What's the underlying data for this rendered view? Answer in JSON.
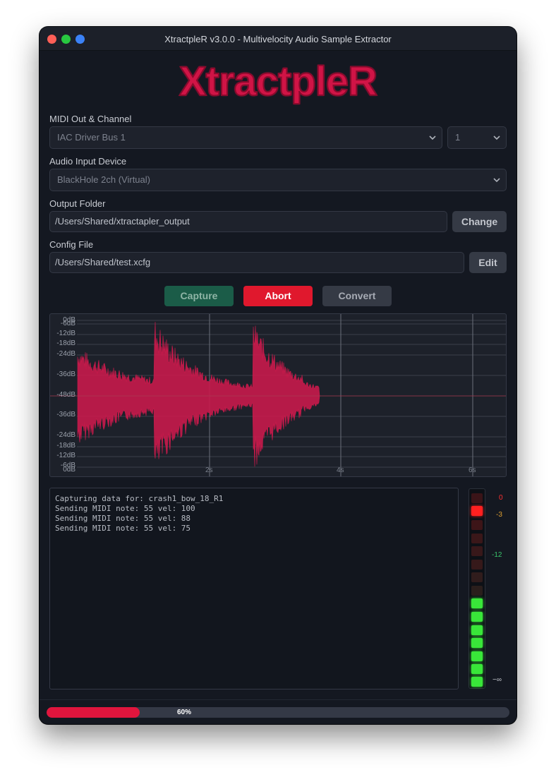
{
  "window": {
    "title": "XtractpleR v3.0.0 - Multivelocity Audio Sample Extractor",
    "logo_text": "XtractpleR"
  },
  "midi": {
    "label": "MIDI Out & Channel",
    "device": "IAC Driver Bus 1",
    "channel": "1"
  },
  "audio": {
    "label": "Audio Input Device",
    "device": "BlackHole 2ch (Virtual)"
  },
  "output": {
    "label": "Output Folder",
    "path": "/Users/Shared/xtractapler_output",
    "change_label": "Change"
  },
  "config": {
    "label": "Config File",
    "path": "/Users/Shared/test.xcfg",
    "edit_label": "Edit"
  },
  "actions": {
    "capture": "Capture",
    "abort": "Abort",
    "convert": "Convert"
  },
  "waveform": {
    "db_labels_top": [
      "0dB",
      "-6dB",
      "-12dB",
      "-18dB",
      "-24dB",
      "-36dB",
      "-48dB"
    ],
    "db_labels_bottom": [
      "-36dB",
      "-24dB",
      "-18dB",
      "-12dB",
      "-6dB",
      "0dB"
    ],
    "time_labels": [
      "2s",
      "4s",
      "6s"
    ],
    "color": "#c81a4b"
  },
  "log": {
    "lines": [
      "Capturing data for: crash1_bow_18_R1",
      "Sending MIDI note: 55 vel: 100",
      "Sending MIDI note: 55 vel: 88",
      "Sending MIDI note: 55 vel: 75"
    ]
  },
  "meter": {
    "labels": {
      "zero": "0",
      "minus3": "-3",
      "minus12": "-12",
      "neg_inf": "−∞"
    },
    "colors": {
      "red": "#ff2020",
      "green": "#39e639",
      "warn": "#e0a030",
      "mid": "#39c46a"
    }
  },
  "progress": {
    "percent": 60,
    "label": "60%"
  }
}
